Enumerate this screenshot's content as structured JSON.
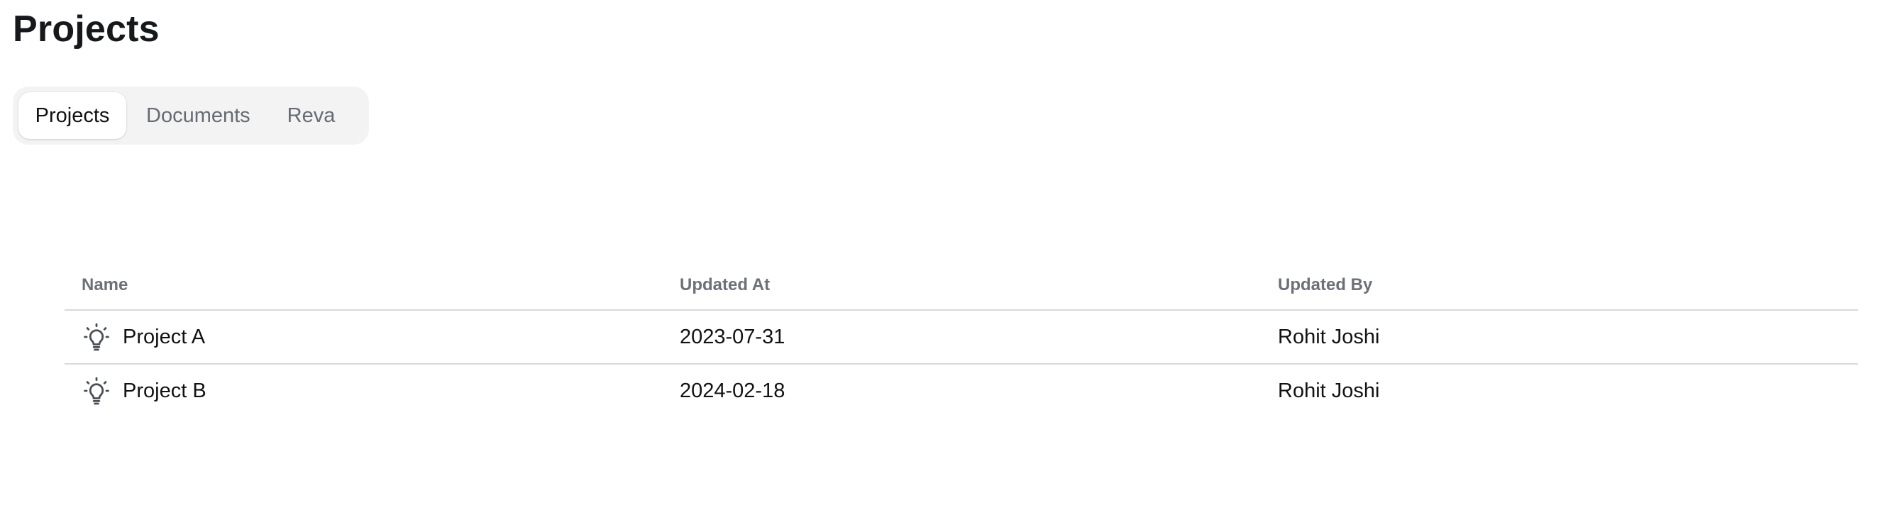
{
  "page": {
    "title": "Projects"
  },
  "tabs": [
    {
      "label": "Projects",
      "active": true
    },
    {
      "label": "Documents",
      "active": false
    },
    {
      "label": "Reva",
      "active": false
    }
  ],
  "table": {
    "columns": [
      "Name",
      "Updated At",
      "Updated By"
    ],
    "rows": [
      {
        "icon": "lightbulb-icon",
        "name": "Project A",
        "updated_at": "2023-07-31",
        "updated_by": "Rohit Joshi"
      },
      {
        "icon": "lightbulb-icon",
        "name": "Project B",
        "updated_at": "2024-02-18",
        "updated_by": "Rohit Joshi"
      }
    ]
  },
  "colors": {
    "tab_bar_bg": "#f3f3f3",
    "active_tab_bg": "#ffffff",
    "header_text": "#6e7079",
    "divider": "#d9d9dc",
    "icon": "#4a4f57"
  }
}
